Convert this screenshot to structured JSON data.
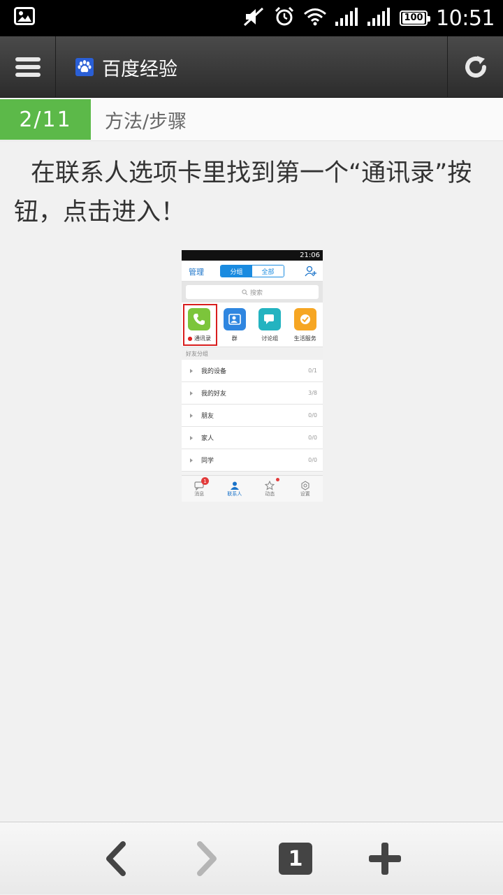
{
  "status_bar": {
    "time": "10:51",
    "battery": "100",
    "icons": [
      "image-icon",
      "mute-icon",
      "alarm-icon",
      "wifi-icon",
      "signal-icon",
      "signal-icon-2",
      "battery-icon"
    ]
  },
  "header": {
    "title": "百度经验",
    "icons": [
      "menu-icon",
      "baidu-paw-icon",
      "refresh-icon"
    ]
  },
  "step": {
    "count": "2/11",
    "heading": "方法/步骤"
  },
  "content": {
    "text": "在联系人选项卡里找到第一个“通讯录”按钮，点击进入！"
  },
  "screenshot": {
    "status_time": "21:06",
    "manage": "管理",
    "segments": [
      "分组",
      "全部"
    ],
    "search_placeholder": "搜索",
    "apps": [
      {
        "label": "通讯录",
        "color": "#7cc53b"
      },
      {
        "label": "群",
        "color": "#2f86e0"
      },
      {
        "label": "讨论组",
        "color": "#23b3c0"
      },
      {
        "label": "生活服务",
        "color": "#f6a623"
      }
    ],
    "groups_title": "好友分组",
    "groups": [
      {
        "name": "我的设备",
        "count": "0/1"
      },
      {
        "name": "我的好友",
        "count": "3/8"
      },
      {
        "name": "朋友",
        "count": "0/0"
      },
      {
        "name": "家人",
        "count": "0/0"
      },
      {
        "name": "同学",
        "count": "0/0"
      }
    ],
    "tabs": [
      {
        "label": "消息",
        "badge": "1"
      },
      {
        "label": "联系人"
      },
      {
        "label": "动态"
      },
      {
        "label": "设置"
      }
    ]
  },
  "toolbar": {
    "tab_count": "1",
    "icons": [
      "back-icon",
      "forward-icon",
      "tabs-icon",
      "add-icon"
    ]
  }
}
